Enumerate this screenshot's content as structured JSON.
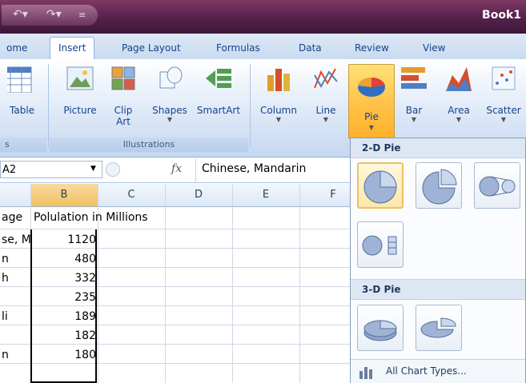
{
  "window": {
    "title": "Book1"
  },
  "tabs": [
    {
      "label": "ome"
    },
    {
      "label": "Insert"
    },
    {
      "label": "Page Layout"
    },
    {
      "label": "Formulas"
    },
    {
      "label": "Data"
    },
    {
      "label": "Review"
    },
    {
      "label": "View"
    }
  ],
  "ribbon": {
    "table_label": "Table",
    "picture_label": "Picture",
    "clip_label_1": "Clip",
    "clip_label_2": "Art",
    "shapes_label": "Shapes",
    "smartart_label": "SmartArt",
    "column_label": "Column",
    "line_label": "Line",
    "pie_label": "Pie",
    "bar_label": "Bar",
    "area_label": "Area",
    "scatter_label": "Scatter",
    "group_tables_fragment": "s",
    "group_illustrations": "Illustrations"
  },
  "formula_bar": {
    "name_box": "A2",
    "fx": "fx",
    "value": "Chinese, Mandarin"
  },
  "grid": {
    "columns": [
      "B",
      "C",
      "D",
      "E",
      "F"
    ],
    "header_row": {
      "a": "age",
      "b": "Polulation in Millions"
    },
    "rows": [
      {
        "a": "se, M",
        "b": "1120"
      },
      {
        "a": "n",
        "b": "480"
      },
      {
        "a": "h",
        "b": "332"
      },
      {
        "a": "",
        "b": "235"
      },
      {
        "a": "li",
        "b": "189"
      },
      {
        "a": "",
        "b": "182"
      },
      {
        "a": "n",
        "b": "180"
      }
    ]
  },
  "dropdown": {
    "section_2d": "2-D Pie",
    "section_3d": "3-D Pie",
    "all_chart_types": "All Chart Types..."
  },
  "colors": {
    "title_bar": "#5a2450",
    "accent": "#ffc44a",
    "ribbon": "#dbe7f7"
  }
}
